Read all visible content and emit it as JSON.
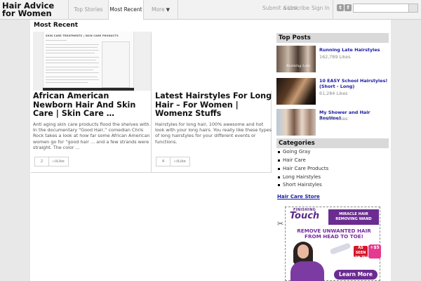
{
  "site": {
    "title": "Hair Advice for Women"
  },
  "nav": {
    "items": [
      {
        "label": "Top Stories"
      },
      {
        "label": "Most Recent"
      },
      {
        "label": "More"
      }
    ],
    "right": [
      {
        "label": "Submit a Link"
      },
      {
        "label": "Subscribe"
      },
      {
        "label": "Sign In"
      }
    ],
    "search": {
      "value": "",
      "placeholder": ""
    }
  },
  "main": {
    "section_title": "Most Recent",
    "posts": [
      {
        "title": "African American Newborn Hair And Skin Care | Skin Care …",
        "excerpt": "Anti aging skin care products flood the shelves with. In the documentary “Good Hair,” comedian Chris Rock takes a look at how far some African American women go for “good hair … and a few strands were straight. The color …",
        "likes": "2",
        "like_label": "Like",
        "thumb_header": "SKIN CARE TREATMENTS | SKIN CARE PRODUCTS"
      },
      {
        "title": "Latest Hairstyles For Long Hair – For Women | Womenz Stuffs",
        "excerpt": "Hairstyles for long hair, 100% awesome and hot look with your long hairs. You really like these types of long hairstyles for your different events or functions.",
        "likes": "4",
        "like_label": "Like"
      }
    ]
  },
  "sidebar": {
    "top_posts_title": "Top Posts",
    "top_posts": [
      {
        "title": "Running Late Hairstyles",
        "likes": "162,789 Likes",
        "thumb_text": "Running Late"
      },
      {
        "title": "10 EASY School Hairstyles! (Short - Long)",
        "likes": "61,284 Likes"
      },
      {
        "title": "My Shower and Hair Routine!",
        "likes": "57,575 Likes"
      }
    ],
    "categories_title": "Categories",
    "categories": [
      {
        "label": "Going Gray"
      },
      {
        "label": "Hair Care"
      },
      {
        "label": "Hair Care Products"
      },
      {
        "label": "Long Hairstyles"
      },
      {
        "label": "Short Hairstyles"
      }
    ],
    "store_link": "Hair Care Store",
    "ad": {
      "brand_small": "FINISHING",
      "brand_big": "Touch",
      "wand_text": "MIRACLE HAIR REMOVING WAND",
      "headline": "REMOVE UNWANTED HAIR FROM HEAD TO TOE!",
      "as_seen": "AS SEEN ON TV",
      "price": "+$5",
      "cta": "Learn More"
    }
  },
  "colors": {
    "link": "#1a1aa6",
    "ad_purple": "#6b2c91",
    "header_gray": "#d9d9d9"
  }
}
